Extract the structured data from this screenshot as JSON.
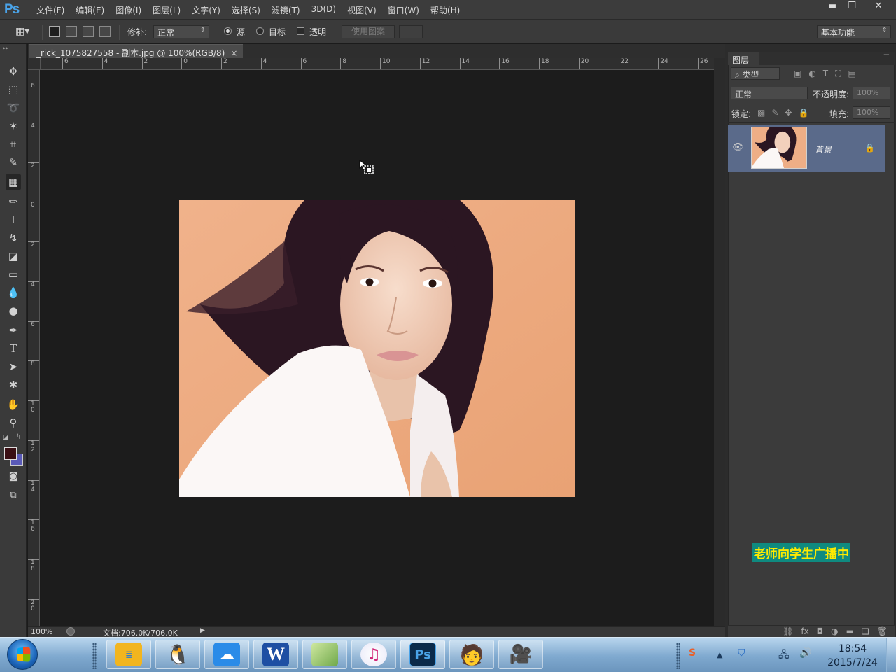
{
  "app": {
    "logo": "Ps",
    "menu": [
      "文件(F)",
      "编辑(E)",
      "图像(I)",
      "图层(L)",
      "文字(Y)",
      "选择(S)",
      "滤镜(T)",
      "3D(D)",
      "视图(V)",
      "窗口(W)",
      "帮助(H)"
    ],
    "window_controls": {
      "minimize": "▬",
      "restore": "❐",
      "close": "✕"
    }
  },
  "options_bar": {
    "patch_label": "修补:",
    "patch_mode": "正常",
    "source_label": "源",
    "source_selected": true,
    "target_label": "目标",
    "transparent_label": "透明",
    "use_pattern_label": "使用图案",
    "workspace": "基本功能"
  },
  "document": {
    "tab_title": "_rick_1075827558 - 副本.jpg @ 100%(RGB/8)",
    "close_glyph": "×",
    "hruler_labels": [
      "6",
      "4",
      "2",
      "0",
      "2",
      "4",
      "6",
      "8",
      "10",
      "12",
      "14",
      "16",
      "18",
      "20",
      "22",
      "24",
      "26"
    ],
    "vruler_labels": [
      "6",
      "4",
      "2",
      "0",
      "2",
      "4",
      "6",
      "8",
      "10",
      "12",
      "14",
      "16",
      "18",
      "20"
    ],
    "zoom": "100%",
    "doc_info": "文档:706.0K/706.0K"
  },
  "layers_panel": {
    "title": "图层",
    "filter_label": "类型",
    "blend_mode": "正常",
    "opacity_label": "不透明度:",
    "opacity_value": "100%",
    "lock_label": "锁定:",
    "fill_label": "填充:",
    "fill_value": "100%",
    "layers": [
      {
        "name": "背景",
        "visible": true,
        "locked": true
      }
    ]
  },
  "overlay": {
    "broadcast_text": "老师向学生广播中"
  },
  "taskbar": {
    "apps": [
      "notes",
      "qq",
      "baidu-cloud",
      "word",
      "green-app",
      "itunes",
      "photoshop",
      "avatar-app",
      "camera-app"
    ],
    "time": "18:54",
    "date": "2015/7/24"
  },
  "colors": {
    "ps_blue": "#4aa3e8",
    "selected_layer": "#5a6a8a",
    "broadcast_bg": "#0f8a80",
    "broadcast_fg": "#ffea00"
  }
}
